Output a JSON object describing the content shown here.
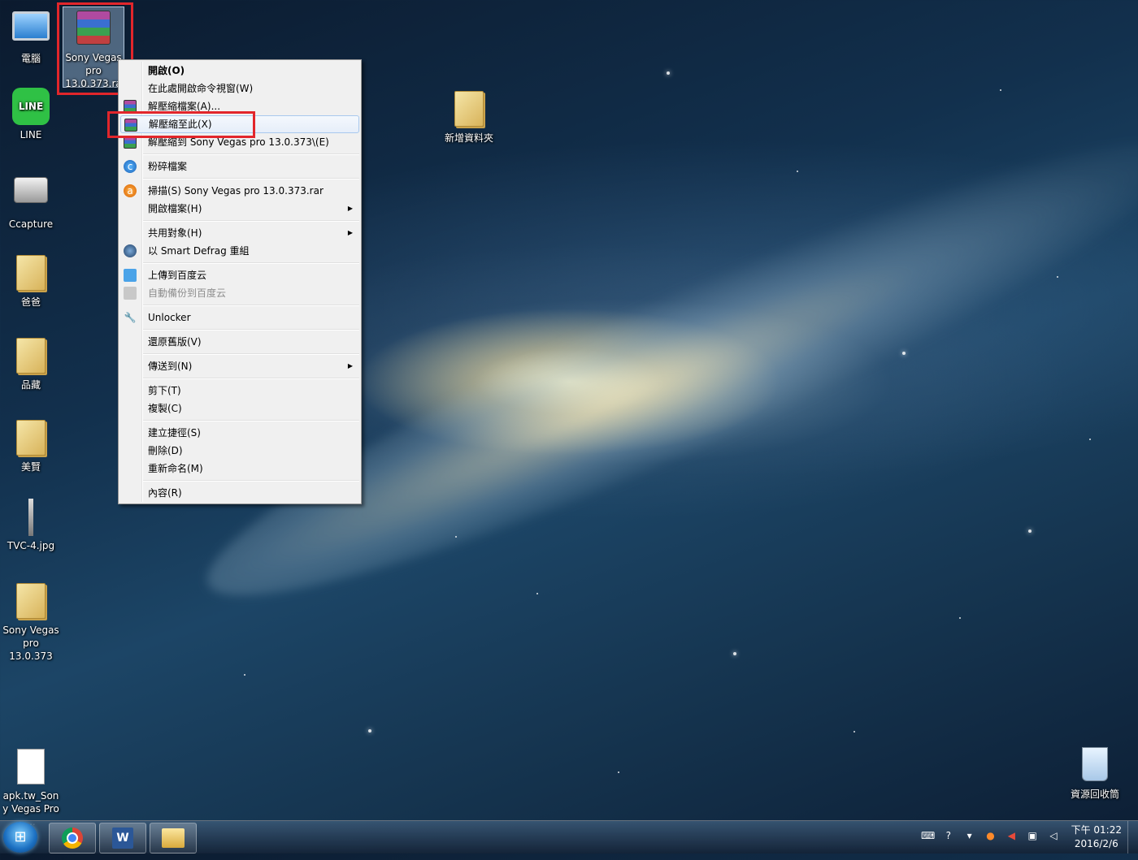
{
  "desktop_icons": {
    "computer": "電腦",
    "line": "LINE",
    "line_logo": "LINE",
    "ccapture": "Ccapture",
    "dad": "爸爸",
    "collection": "品藏",
    "meixian": "美賢",
    "tvc": "TVC-4.jpg",
    "sony_folder": "Sony Vegas pro 13.0.373",
    "apk_doc": "apk.tw_Sony Vegas Pro ...",
    "new_folder": "新增資料夾",
    "recycle_bin": "資源回收筒",
    "rar_file": "Sony Vegas pro 13.0.373.ra"
  },
  "context_menu": {
    "open": "開啟(O)",
    "cmd_here": "在此處開啟命令視窗(W)",
    "extract_files": "解壓縮檔案(A)...",
    "extract_here": "解壓縮至此(X)",
    "extract_to": "解壓縮到 Sony Vegas pro 13.0.373\\(E)",
    "shred": "粉碎檔案",
    "scan": "掃描(S) Sony Vegas pro 13.0.373.rar",
    "open_with": "開啟檔案(H)",
    "share_with": "共用對象(H)",
    "smart_defrag": "以 Smart Defrag 重組",
    "upload_baidu": "上傳到百度云",
    "auto_backup_baidu": "自動備份到百度云",
    "unlocker": "Unlocker",
    "restore_previous": "還原舊版(V)",
    "send_to": "傳送到(N)",
    "cut": "剪下(T)",
    "copy": "複製(C)",
    "create_shortcut": "建立捷徑(S)",
    "delete": "刪除(D)",
    "rename": "重新命名(M)",
    "properties": "內容(R)"
  },
  "taskbar": {
    "word_letter": "W",
    "clock_time": "下午 01:22",
    "clock_date": "2016/2/6"
  },
  "icons": [
    "computer-icon",
    "line-icon",
    "camera-icon",
    "folder-icon",
    "document-icon",
    "rar-archive-icon",
    "recycle-bin-icon",
    "windows-start-icon",
    "chrome-icon",
    "word-icon",
    "explorer-icon",
    "help-icon",
    "speaker-icon"
  ],
  "colors": {
    "highlight_red": "#e2262b",
    "menu_bg": "#f0f0f0",
    "line_green": "#2fc145"
  }
}
